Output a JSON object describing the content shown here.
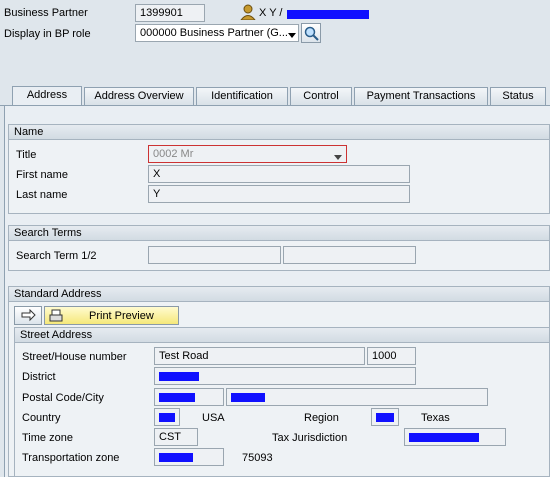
{
  "header": {
    "bp_label": "Business Partner",
    "bp_number": "1399901",
    "bp_name_prefix": "X Y /",
    "role_label": "Display in BP role",
    "role_value": "000000 Business Partner (G..."
  },
  "tabs": [
    {
      "label": "Address"
    },
    {
      "label": "Address Overview"
    },
    {
      "label": "Identification"
    },
    {
      "label": "Control"
    },
    {
      "label": "Payment Transactions"
    },
    {
      "label": "Status"
    }
  ],
  "name_section": {
    "title": "Name",
    "title_label": "Title",
    "title_value": "0002 Mr",
    "first_name_label": "First name",
    "first_name_value": "X",
    "last_name_label": "Last name",
    "last_name_value": "Y"
  },
  "search_section": {
    "title": "Search Terms",
    "label": "Search Term 1/2",
    "term1": "",
    "term2": ""
  },
  "address_section": {
    "title": "Standard Address",
    "print_preview": "Print Preview",
    "street_title": "Street Address",
    "street_label": "Street/House number",
    "street_value": "Test Road",
    "house_number": "1000",
    "district_label": "District",
    "postal_label": "Postal Code/City",
    "country_label": "Country",
    "country_text": "USA",
    "region_label": "Region",
    "region_text": "Texas",
    "timezone_label": "Time zone",
    "timezone_value": "CST",
    "taxjur_label": "Tax Jurisdiction",
    "transport_label": "Transportation zone",
    "transport_text": "75093"
  },
  "colors": {
    "redaction": "#1010ff",
    "background": "#dfe6ec",
    "accent_button": "#fff7a8"
  },
  "icons": [
    "person-icon",
    "dropdown-arrow-icon",
    "magnifier-icon",
    "transfer-icon",
    "printer-icon"
  ]
}
